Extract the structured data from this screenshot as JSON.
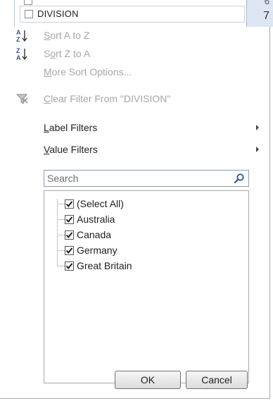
{
  "sheet": {
    "field_label": "DIVISION",
    "row_numbers": [
      "6",
      "7"
    ]
  },
  "menu": {
    "sort_a_to_z": {
      "label": "Sort A to Z",
      "icon": "sort-ascending-icon",
      "enabled": false
    },
    "sort_z_to_a": {
      "label": "Sort Z to A",
      "icon": "sort-descending-icon",
      "enabled": false
    },
    "more_sort_options": {
      "label": "More Sort Options...",
      "enabled": false
    },
    "clear_filter": {
      "label": "Clear Filter From \"DIVISION\"",
      "icon": "clear-filter-icon",
      "enabled": false
    },
    "label_filters": {
      "label": "Label Filters",
      "has_submenu": true
    },
    "value_filters": {
      "label": "Value Filters",
      "has_submenu": true
    }
  },
  "search": {
    "placeholder": "Search",
    "value": "",
    "icon": "search-icon"
  },
  "filter_list": [
    {
      "label": "(Select All)",
      "checked": true
    },
    {
      "label": "Australia",
      "checked": true
    },
    {
      "label": "Canada",
      "checked": true
    },
    {
      "label": "Germany",
      "checked": true
    },
    {
      "label": "Great Britain",
      "checked": true
    }
  ],
  "buttons": {
    "ok": "OK",
    "cancel": "Cancel"
  },
  "colors": {
    "disabled_text": "#a6a6a6",
    "header_cell": "#dde6f2",
    "search_icon": "#2b5797"
  }
}
